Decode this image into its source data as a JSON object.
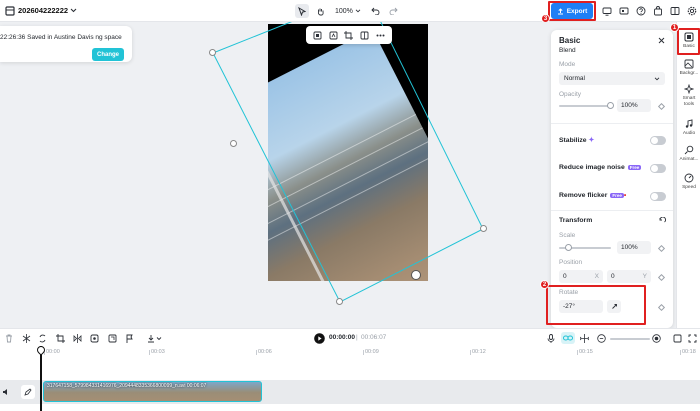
{
  "topbar": {
    "project_name": "202604222222",
    "zoom": "100%",
    "export_label": "Export"
  },
  "badges": {
    "one": "1",
    "two": "2",
    "three": "3"
  },
  "toast": {
    "message": "22:26:36 Saved in Austine Davis ng space",
    "change_label": "Change"
  },
  "panel": {
    "title": "Basic",
    "blend_label": "Blend",
    "mode_label": "Mode",
    "mode_value": "Normal",
    "opacity_label": "Opacity",
    "opacity_value": "100%",
    "stabilize_label": "Stabilize",
    "noise_label": "Reduce image noise",
    "flicker_label": "Remove flicker",
    "free_badge": "Free",
    "transform_label": "Transform",
    "scale_label": "Scale",
    "scale_value": "100%",
    "position_label": "Position",
    "pos_x_value": "0",
    "pos_x_axis": "X",
    "pos_y_value": "0",
    "pos_y_axis": "Y",
    "rotate_label": "Rotate",
    "rotate_value": "-27°"
  },
  "rail": {
    "items": [
      {
        "label": "Basic",
        "icon": "basic-icon"
      },
      {
        "label": "Backgr...",
        "icon": "background-icon"
      },
      {
        "label": "Smart tools",
        "icon": "smart-tools-icon"
      },
      {
        "label": "Audio",
        "icon": "audio-icon"
      },
      {
        "label": "Animat...",
        "icon": "animation-icon"
      },
      {
        "label": "Speed",
        "icon": "speed-icon"
      }
    ]
  },
  "timeline": {
    "current_time": "00:00:00",
    "separator": "|",
    "total_time": "00:06:07",
    "ticks": [
      "00:00",
      "00:03",
      "00:06",
      "00:09",
      "00:12",
      "00:15",
      "00:18"
    ],
    "clip_label": "317647158_579984331416976_2094448335366800099_n.avi  00:06:07"
  },
  "colors": {
    "accent": "#1f7ff5",
    "highlight": "#e02020",
    "selection": "#22c3d6"
  }
}
